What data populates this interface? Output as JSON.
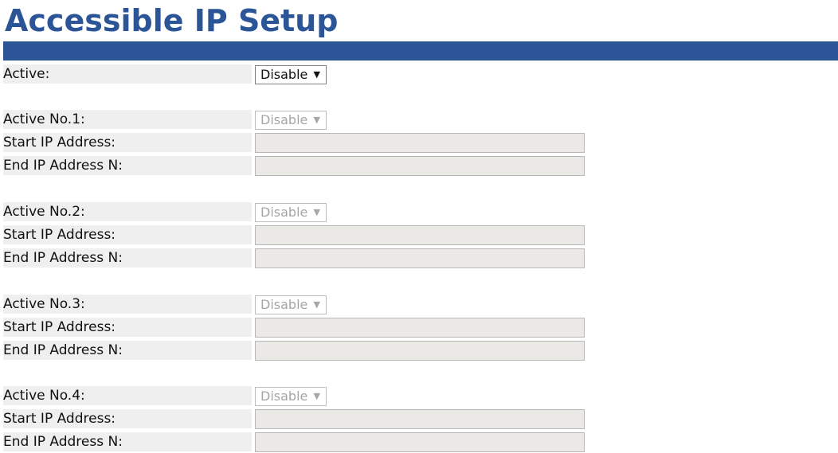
{
  "page": {
    "title": "Accessible IP Setup"
  },
  "main": {
    "active_label": "Active:",
    "active_value": "Disable",
    "groups": [
      {
        "label": "Active No.1:",
        "value": "Disable",
        "start_label": "Start IP Address:",
        "end_label": "End IP Address N:",
        "start_value": "",
        "end_value": ""
      },
      {
        "label": "Active No.2:",
        "value": "Disable",
        "start_label": "Start IP Address:",
        "end_label": "End IP Address N:",
        "start_value": "",
        "end_value": ""
      },
      {
        "label": "Active No.3:",
        "value": "Disable",
        "start_label": "Start IP Address:",
        "end_label": "End IP Address N:",
        "start_value": "",
        "end_value": ""
      },
      {
        "label": "Active No.4:",
        "value": "Disable",
        "start_label": "Start IP Address:",
        "end_label": "End IP Address N:",
        "start_value": "",
        "end_value": ""
      }
    ]
  },
  "icons": {
    "dropdown": "caret-down-icon"
  },
  "colors": {
    "header": "#2b5597",
    "label_bg": "#efefef",
    "disabled_input": "#ebe9e5"
  }
}
